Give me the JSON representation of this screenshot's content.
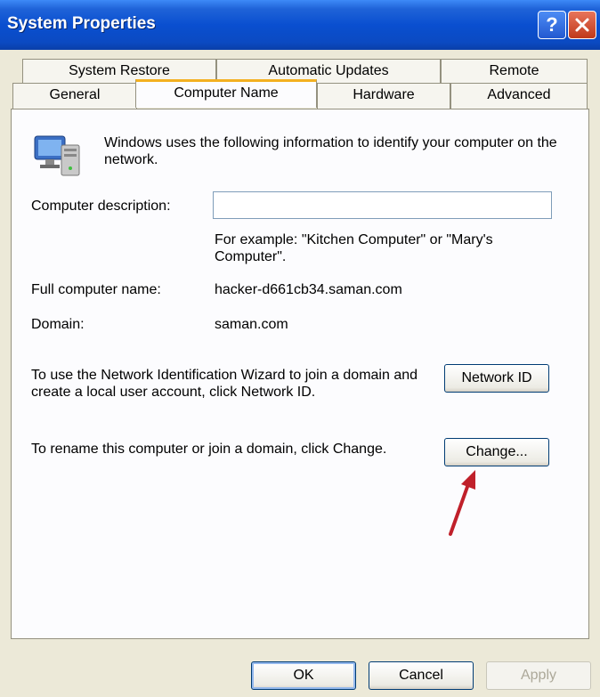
{
  "window": {
    "title": "System Properties",
    "help_glyph": "?"
  },
  "tabs": {
    "row1": [
      "System Restore",
      "Automatic Updates",
      "Remote"
    ],
    "row2": [
      "General",
      "Computer Name",
      "Hardware",
      "Advanced"
    ],
    "active": "Computer Name"
  },
  "content": {
    "intro": "Windows uses the following information to identify your computer on the network.",
    "description_label": "Computer description:",
    "description_value": "",
    "example": "For example: \"Kitchen Computer\" or \"Mary's Computer\".",
    "full_name_label": "Full computer name:",
    "full_name_value": "hacker-d661cb34.saman.com",
    "domain_label": "Domain:",
    "domain_value": "saman.com",
    "network_id_text": "To use the Network Identification Wizard to join a domain and create a local user account, click Network ID.",
    "network_id_button": "Network ID",
    "rename_text": "To rename this computer or join a domain, click Change.",
    "change_button": "Change..."
  },
  "footer": {
    "ok": "OK",
    "cancel": "Cancel",
    "apply": "Apply"
  },
  "colors": {
    "title_blue": "#0a4fd0",
    "tab_highlight": "#f3b020",
    "annotation_arrow": "#c0202a"
  },
  "icons": [
    "help-icon",
    "close-icon",
    "computer-network-icon",
    "red-arrow-annotation"
  ]
}
